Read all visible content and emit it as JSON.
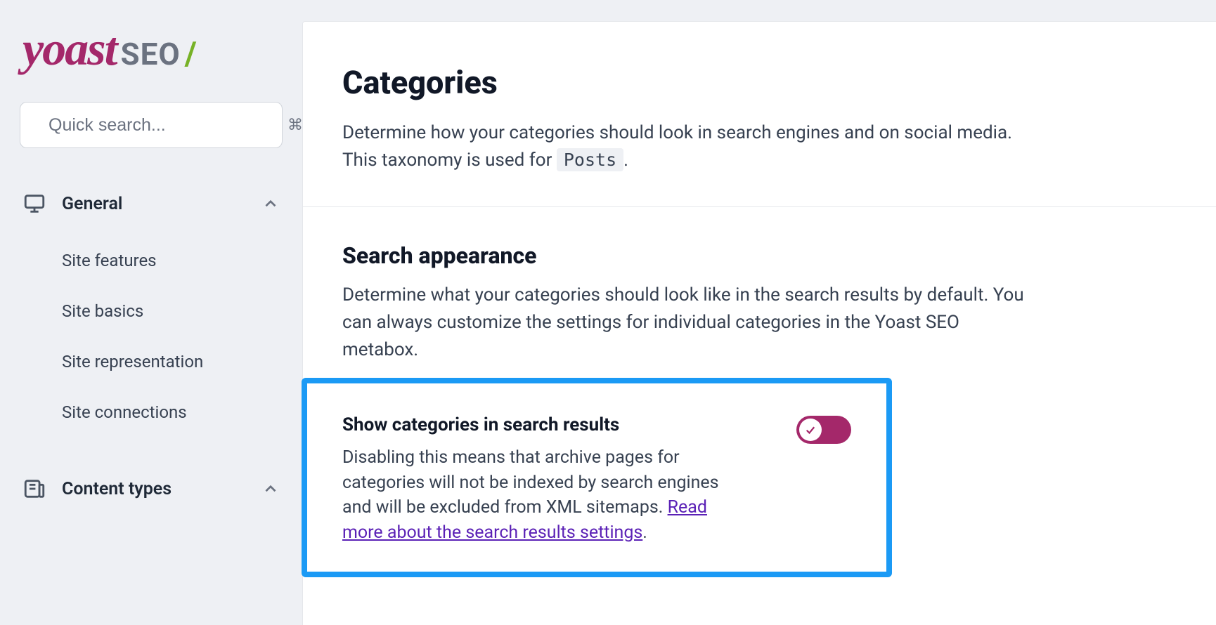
{
  "brand": {
    "name": "yoast",
    "suffix": "SEO",
    "slash": "/"
  },
  "search": {
    "placeholder": "Quick search...",
    "shortcut": "⌘K"
  },
  "sidebar": {
    "groups": [
      {
        "label": "General",
        "expanded": true,
        "items": [
          {
            "label": "Site features"
          },
          {
            "label": "Site basics"
          },
          {
            "label": "Site representation"
          },
          {
            "label": "Site connections"
          }
        ]
      },
      {
        "label": "Content types",
        "expanded": true,
        "items": []
      }
    ]
  },
  "page": {
    "title": "Categories",
    "description_pre": "Determine how your categories should look in search engines and on social media. This taxonomy is used for ",
    "description_chip": "Posts",
    "description_post": "."
  },
  "section": {
    "title": "Search appearance",
    "description": "Determine what your categories should look like in the search results by default. You can always customize the settings for individual categories in the Yoast SEO metabox."
  },
  "setting": {
    "title": "Show categories in search results",
    "description_pre": "Disabling this means that archive pages for categories will not be indexed by search engines and will be excluded from XML sitemaps. ",
    "link_text": "Read more about the search results settings",
    "description_post": ".",
    "enabled": true
  }
}
